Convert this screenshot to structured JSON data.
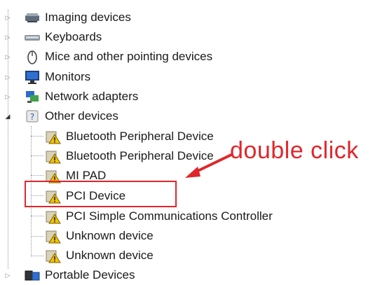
{
  "tree": {
    "categories": [
      {
        "label": "Imaging devices",
        "icon": "scanner-icon",
        "expanded": false
      },
      {
        "label": "Keyboards",
        "icon": "keyboard-icon",
        "expanded": false
      },
      {
        "label": "Mice and other pointing devices",
        "icon": "mouse-icon",
        "expanded": false
      },
      {
        "label": "Monitors",
        "icon": "monitor-icon",
        "expanded": false
      },
      {
        "label": "Network adapters",
        "icon": "network-adapter-icon",
        "expanded": false
      },
      {
        "label": "Other devices",
        "icon": "unknown-device-icon",
        "expanded": true
      },
      {
        "label": "Portable Devices",
        "icon": "portable-device-icon",
        "expanded": false
      }
    ],
    "other_devices_children": [
      {
        "label": "Bluetooth Peripheral Device",
        "icon": "warning-device-icon"
      },
      {
        "label": "Bluetooth Peripheral Device",
        "icon": "warning-device-icon"
      },
      {
        "label": "MI PAD",
        "icon": "warning-device-icon"
      },
      {
        "label": "PCI Device",
        "icon": "warning-device-icon"
      },
      {
        "label": "PCI Simple Communications Controller",
        "icon": "warning-device-icon"
      },
      {
        "label": "Unknown device",
        "icon": "warning-device-icon"
      },
      {
        "label": "Unknown device",
        "icon": "warning-device-icon"
      }
    ]
  },
  "annotation": {
    "text": "double click",
    "color": "#e0262b"
  },
  "colors": {
    "highlight": "#e0262b",
    "warning": "#f2c200"
  }
}
